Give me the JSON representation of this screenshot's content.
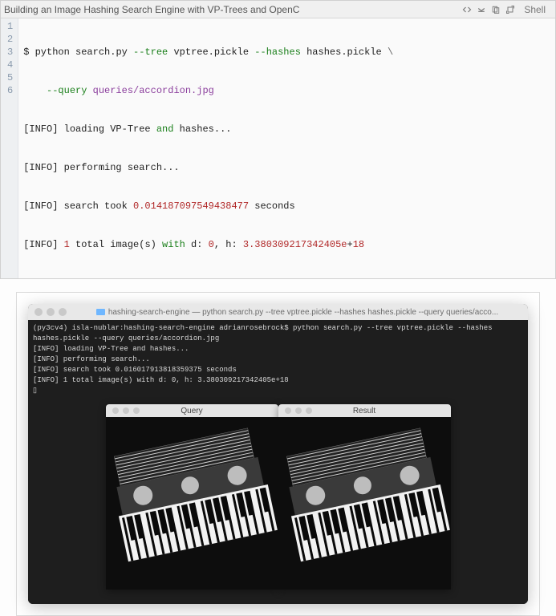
{
  "toolbar": {
    "title": "Building an Image Hashing Search Engine with VP-Trees and OpenC",
    "shell_label": "Shell",
    "icons": [
      "code-icon",
      "collapse-icon",
      "copy-icon",
      "expand-icon"
    ]
  },
  "code": {
    "line_numbers": [
      "1",
      "2",
      "3",
      "4",
      "5",
      "6"
    ],
    "l1_prompt": "$ ",
    "l1_python": "python ",
    "l1_script": "search.py ",
    "l1_opt1": "--tree ",
    "l1_val1": "vptree.pickle ",
    "l1_opt2": "--hashes ",
    "l1_val2": "hashes.pickle ",
    "l1_cont": "\\",
    "l2_indent": "    ",
    "l2_opt": "--query ",
    "l2_val": "queries/accordion.jpg",
    "l3_a": "[INFO] loading VP-Tree ",
    "l3_b": "and",
    "l3_c": " hashes...",
    "l4": "[INFO] performing search...",
    "l5_a": "[INFO] search took ",
    "l5_b": "0.014187097549438477",
    "l5_c": " seconds",
    "l6_a": "[INFO] ",
    "l6_b": "1",
    "l6_c": " total image(s) ",
    "l6_d": "with",
    "l6_e": " d: ",
    "l6_f": "0",
    "l6_g": ", h: ",
    "l6_h": "3.380309217342405e",
    "l6_i": "+",
    "l6_j": "18"
  },
  "terminal": {
    "window_title": "hashing-search-engine — python search.py --tree vptree.pickle --hashes hashes.pickle --query queries/acco...",
    "body": "(py3cv4) isla-nublar:hashing-search-engine adrianrosebrock$ python search.py --tree vptree.pickle --hashes hashes.pickle --query queries/accordion.jpg\n[INFO] loading VP-Tree and hashes...\n[INFO] performing search...\n[INFO] search took 0.016017913818359375 seconds\n[INFO] 1 total image(s) with d: 0, h: 3.380309217342405e+18\n▯"
  },
  "image_windows": {
    "query_title": "Query",
    "result_title": "Result"
  }
}
